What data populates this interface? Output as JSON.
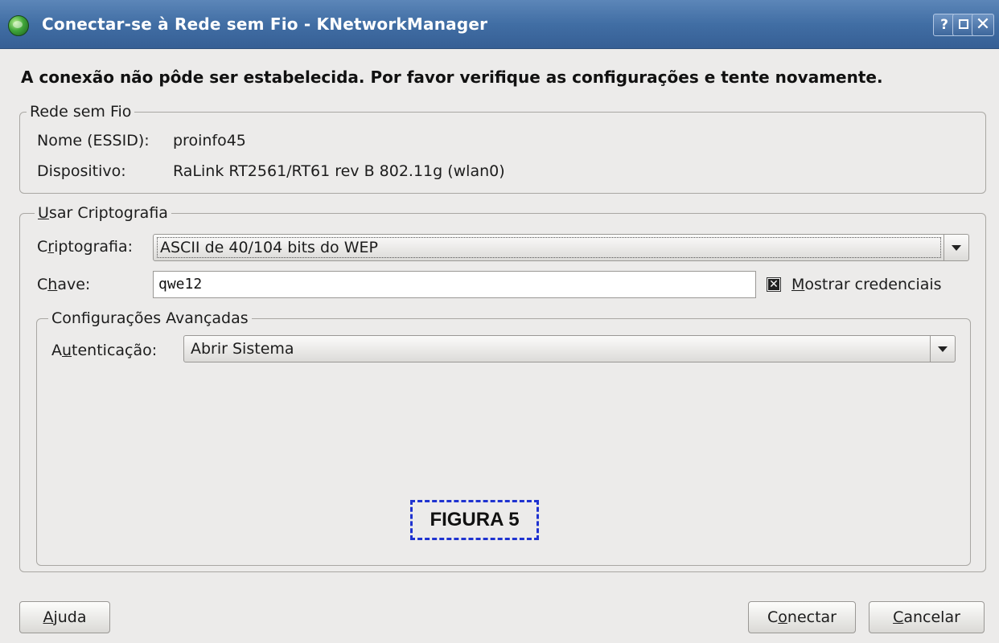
{
  "window": {
    "title": "Conectar-se à Rede sem Fio - KNetworkManager",
    "help_btn": "?",
    "close_btn": "✕"
  },
  "error_message": "A conexão não pôde ser estabelecida. Por favor verifique as configurações e tente novamente.",
  "wireless_group": {
    "title": "Rede sem Fio",
    "essid_label": "Nome (ESSID):",
    "essid_value": "proinfo45",
    "device_label": "Dispositivo:",
    "device_value": "RaLink RT2561/RT61 rev B 802.11g (wlan0)"
  },
  "crypto_group": {
    "title_prefix": "U",
    "title_rest": "sar Criptografia",
    "crypto_label_a": "C",
    "crypto_label_u": "r",
    "crypto_label_b": "iptografia:",
    "crypto_value": "ASCII de 40/104 bits do WEP",
    "key_label_a": "C",
    "key_label_u": "h",
    "key_label_b": "ave:",
    "key_value": "qwe12",
    "show_credentials_u": "M",
    "show_credentials_rest": "ostrar credenciais",
    "show_credentials_checked": true
  },
  "advanced_group": {
    "title": "Configurações Avançadas",
    "auth_label_a": "A",
    "auth_label_u": "u",
    "auth_label_b": "tenticação:",
    "auth_value": "Abrir Sistema"
  },
  "figure_label": "FIGURA 5",
  "buttons": {
    "help_u": "A",
    "help_rest": "juda",
    "connect_a": "C",
    "connect_u": "o",
    "connect_b": "nectar",
    "cancel_u": "C",
    "cancel_rest": "ancelar"
  },
  "colors": {
    "titlebar": "#416ea4",
    "dialog_bg": "#ecebea",
    "figure_border": "#1f33d0"
  }
}
